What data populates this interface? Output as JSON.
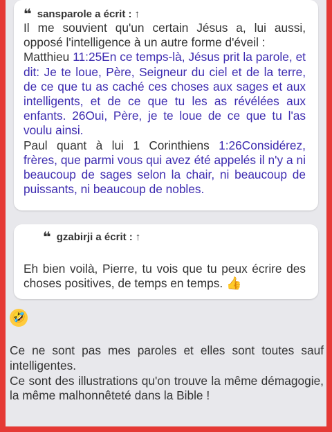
{
  "quote1": {
    "author": "sansparole a écrit :",
    "arrow": "↑",
    "lines": {
      "l1": "Il me souvient qu'un certain Jésus a, lui aussi, opposé l'intelligence à un autre forme d'éveil :",
      "l2": "Matthieu ",
      "l2_ref": "11:25En ce temps-là, Jésus prit la parole, et dit: Je te loue, Père, Seigneur du ciel et de la terre, de ce que tu as caché ces choses aux sages et aux intelligents, et de ce que tu les as révélées aux enfants. 26Oui, Père, je te loue de ce que tu l'as voulu ainsi.",
      "l3": "Paul quant à lui 1 Corinthiens ",
      "l3_ref": "1:26Considérez, frères, que parmi vous qui avez été appelés il n'y a ni beaucoup de sages selon la chair, ni beaucoup de puissants, ni beaucoup de nobles."
    }
  },
  "quote2": {
    "author": "gzabirji a écrit :",
    "arrow": "↑",
    "text": "Eh bien voilà, Pierre, tu vois que tu peux écrire des choses positives, de temps en temps. ",
    "emoji": "👍"
  },
  "reply": {
    "emoji": "🤣",
    "p1": "Ce ne sont pas mes paroles et elles sont toutes sauf intelligentes.",
    "p2": "Ce sont des illustrations qu'on trouve la même démagogie, la même malhonnêteté dans la Bible !"
  },
  "colors": {
    "frame": "#e53935",
    "link_purple": "#3d2bb0",
    "background": "#e8e8ec"
  }
}
